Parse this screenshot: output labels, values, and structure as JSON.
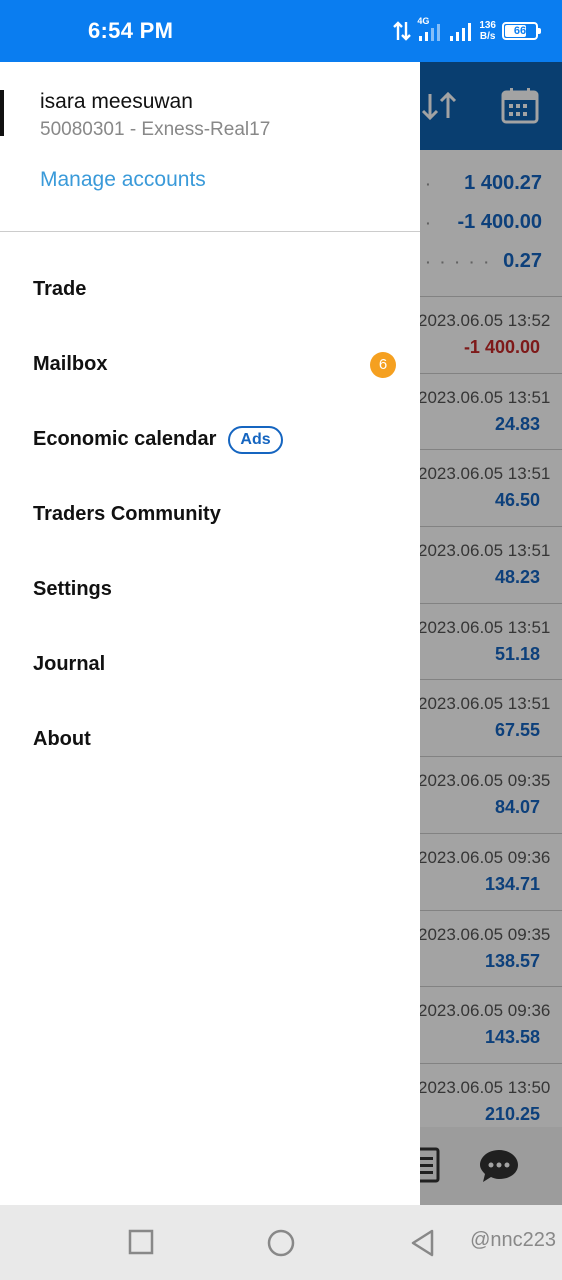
{
  "status_bar": {
    "time": "6:54 PM",
    "network_type": "4G",
    "net_speed_value": "136",
    "net_speed_unit": "B/s",
    "battery": "66"
  },
  "drawer": {
    "user_name": "isara meesuwan",
    "account_line": "50080301 - Exness-Real17",
    "manage_accounts": "Manage accounts",
    "menu": [
      {
        "label": "Trade"
      },
      {
        "label": "Mailbox",
        "badge": "6"
      },
      {
        "label": "Economic calendar",
        "tag": "Ads"
      },
      {
        "label": "Traders Community"
      },
      {
        "label": "Settings"
      },
      {
        "label": "Journal"
      },
      {
        "label": "About"
      }
    ]
  },
  "background": {
    "summary": [
      "1 400.27",
      "-1 400.00",
      "0.27"
    ],
    "deals": [
      {
        "time": "2023.06.05 13:52",
        "value": "-1 400.00",
        "negative": true
      },
      {
        "time": "2023.06.05 13:51",
        "value": "24.83"
      },
      {
        "time": "2023.06.05 13:51",
        "value": "46.50"
      },
      {
        "time": "2023.06.05 13:51",
        "value": "48.23"
      },
      {
        "time": "2023.06.05 13:51",
        "value": "51.18"
      },
      {
        "time": "2023.06.05 13:51",
        "value": "67.55"
      },
      {
        "time": "2023.06.05 09:35",
        "value": "84.07"
      },
      {
        "time": "2023.06.05 09:36",
        "value": "134.71"
      },
      {
        "time": "2023.06.05 09:35",
        "value": "138.57"
      },
      {
        "time": "2023.06.05 09:36",
        "value": "143.58"
      },
      {
        "time": "2023.06.05 13:50",
        "value": "210.25"
      }
    ]
  },
  "watermark": "@nnc223",
  "colors": {
    "status_bar": "#0a7df0",
    "app_header": "#0f62b0",
    "positive_value": "#1565c0",
    "negative_value": "#c62828",
    "badge": "#f5a020",
    "link": "#3a9ad9"
  },
  "icons": {
    "sort": "sort-icon",
    "calendar": "calendar-icon",
    "history": "history-icon",
    "chat": "chat-icon",
    "nav_recents": "recents-square-icon",
    "nav_home": "home-circle-icon",
    "nav_back": "back-triangle-icon"
  }
}
